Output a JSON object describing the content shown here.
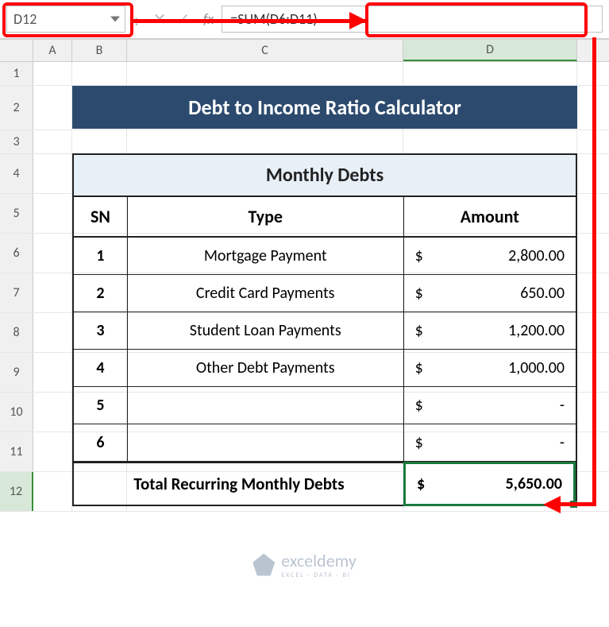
{
  "formula_bar": {
    "name_box": "D12",
    "formula": "=SUM(D6:D11)",
    "fx_label": "fx"
  },
  "columns": [
    "A",
    "B",
    "C",
    "D"
  ],
  "row_numbers": [
    "1",
    "2",
    "3",
    "4",
    "5",
    "6",
    "7",
    "8",
    "9",
    "10",
    "11",
    "12"
  ],
  "active_column": "D",
  "active_row": "12",
  "title": "Debt to Income Ratio Calculator",
  "table": {
    "header": "Monthly Debts",
    "cols": {
      "sn": "SN",
      "type": "Type",
      "amount": "Amount"
    },
    "rows": [
      {
        "sn": "1",
        "type": "Mortgage Payment",
        "cur": "$",
        "amt": "2,800.00"
      },
      {
        "sn": "2",
        "type": "Credit Card Payments",
        "cur": "$",
        "amt": "650.00"
      },
      {
        "sn": "3",
        "type": "Student Loan Payments",
        "cur": "$",
        "amt": "1,200.00"
      },
      {
        "sn": "4",
        "type": "Other Debt Payments",
        "cur": "$",
        "amt": "1,000.00"
      },
      {
        "sn": "5",
        "type": "",
        "cur": "$",
        "amt": "-"
      },
      {
        "sn": "6",
        "type": "",
        "cur": "$",
        "amt": "-"
      }
    ],
    "total_label": "Total Recurring Monthly Debts",
    "total_cur": "$",
    "total_amt": "5,650.00"
  },
  "watermark": {
    "brand": "exceldemy",
    "tagline": "EXCEL · DATA · BI"
  }
}
